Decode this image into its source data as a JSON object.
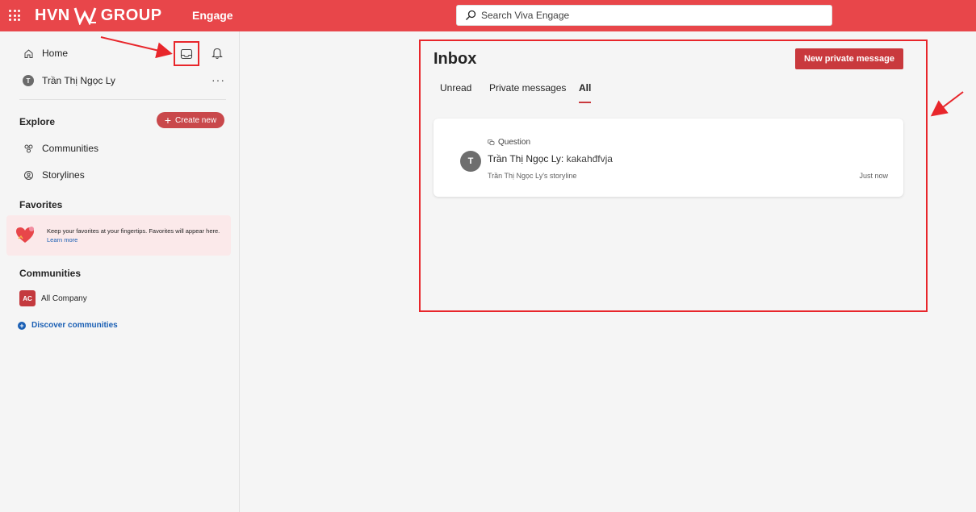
{
  "topbar": {
    "brand_left": "HVN",
    "brand_right": "GROUP",
    "app_name": "Engage",
    "search_placeholder": "Search Viva Engage",
    "icons": [
      "waffle-icon",
      "search-icon"
    ]
  },
  "sidebar": {
    "home_label": "Home",
    "user_name": "Trần Thị Ngọc Ly",
    "user_initial": "T",
    "more_label": "···",
    "explore_title": "Explore",
    "create_new_label": "Create new",
    "explore_items": [
      {
        "label": "Communities",
        "icon": "communities-icon"
      },
      {
        "label": "Storylines",
        "icon": "storylines-icon"
      }
    ],
    "favorites_title": "Favorites",
    "favorites_text": "Keep your favorites at your fingertips. Favorites will appear here.",
    "favorites_link": "Learn more",
    "communities_title": "Communities",
    "community_badge": "AC",
    "community_name": "All Company",
    "discover_label": "Discover communities"
  },
  "inbox": {
    "title": "Inbox",
    "new_message_label": "New private message",
    "tabs": [
      {
        "label": "Unread",
        "active": false
      },
      {
        "label": "Private messages",
        "active": false
      },
      {
        "label": "All",
        "active": true
      }
    ],
    "messages": [
      {
        "type": "Question",
        "author": "Trần Thị Ngọc Ly:",
        "body": "kakahđfvja",
        "initial": "T",
        "source": "Trần Thị Ngọc Ly's storyline",
        "time": "Just now"
      }
    ]
  },
  "colors": {
    "brand": "#e8464a",
    "accent": "#c9393d",
    "annotation": "#e8262b",
    "link": "#1a5fb4"
  }
}
